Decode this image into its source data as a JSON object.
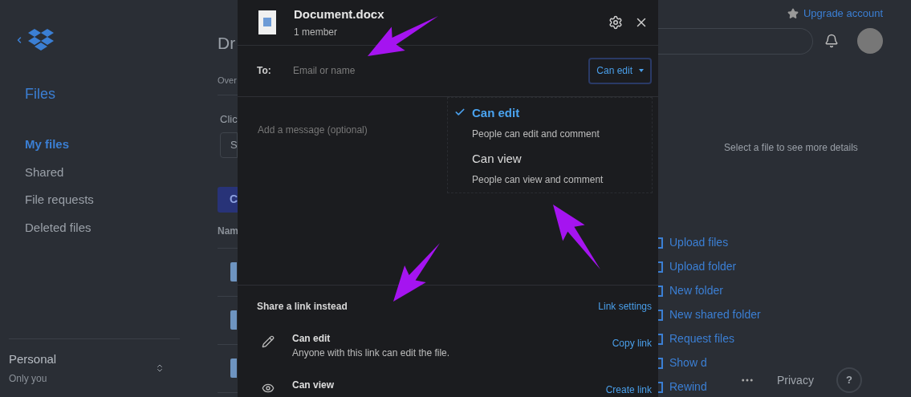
{
  "sidebar": {
    "section_title": "Files",
    "items": [
      {
        "label": "My files",
        "selected": true
      },
      {
        "label": "Shared",
        "selected": false
      },
      {
        "label": "File requests",
        "selected": false
      },
      {
        "label": "Deleted files",
        "selected": false
      }
    ],
    "account": {
      "name": "Personal",
      "subtitle": "Only you"
    }
  },
  "background_page": {
    "title": "Dr",
    "tab": "Over",
    "prompt": "Clic",
    "field": "S",
    "button": "C",
    "column_header": "Nam"
  },
  "share_dialog": {
    "file_name": "Document.docx",
    "members": "1 member",
    "to_label": "To:",
    "to_placeholder": "Email or name",
    "permission_button": "Can edit",
    "permission_menu": [
      {
        "label": "Can edit",
        "description": "People can edit and comment",
        "selected": true
      },
      {
        "label": "Can view",
        "description": "People can view and comment",
        "selected": false
      }
    ],
    "message_placeholder": "Add a message (optional)",
    "link_section": {
      "title": "Share a link instead",
      "settings_link": "Link settings",
      "links": [
        {
          "kind": "edit",
          "label": "Can edit",
          "description": "Anyone with this link can edit the file.",
          "action": "Copy link"
        },
        {
          "kind": "view",
          "label": "Can view",
          "action": "Create link"
        }
      ]
    }
  },
  "top_bar": {
    "upgrade_link": "Upgrade account"
  },
  "details_panel": {
    "empty_text": "Select a file to see more details"
  },
  "actions": [
    "Upload files",
    "Upload folder",
    "New folder",
    "New shared folder",
    "Request files",
    "Show d",
    "Rewind"
  ],
  "footer": {
    "privacy": "Privacy",
    "help": "?"
  }
}
